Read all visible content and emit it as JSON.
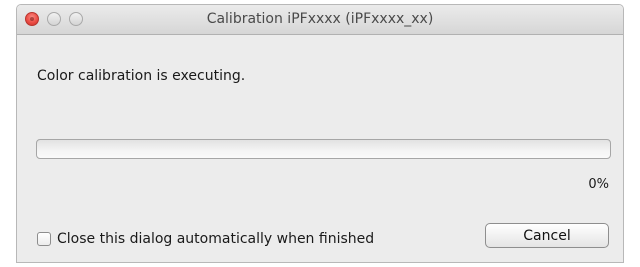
{
  "window": {
    "title": "Calibration iPFxxxx (iPFxxxx_xx)"
  },
  "dialog": {
    "message": "Color calibration is executing.",
    "progress_percent": 0,
    "progress_label": "0%",
    "checkbox_label": "Close this dialog automatically when finished",
    "checkbox_checked": false,
    "cancel_label": "Cancel"
  },
  "colors": {
    "close_button": "#ec4e46",
    "window_background": "#ececec"
  },
  "icons": {
    "close": "close-icon",
    "minimize": "minimize-icon",
    "maximize": "maximize-icon"
  }
}
